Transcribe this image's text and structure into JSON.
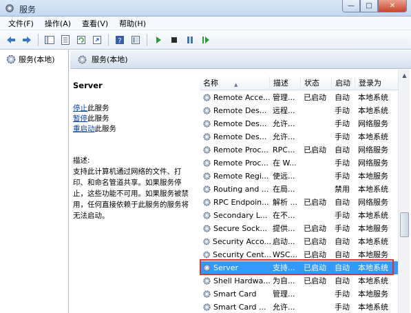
{
  "window": {
    "title": "服务",
    "minimize": "—",
    "maximize": "□",
    "close": "✕"
  },
  "menu": [
    "文件(F)",
    "操作(A)",
    "查看(V)",
    "帮助(H)"
  ],
  "tree": {
    "root_label": "服务(本地)"
  },
  "pane": {
    "header_label": "服务(本地)"
  },
  "details": {
    "service_name": "Server",
    "stop_link": "停止",
    "stop_rest": "此服务",
    "pause_link": "暂停",
    "pause_rest": "此服务",
    "restart_link": "重启动",
    "restart_rest": "此服务",
    "desc_label": "描述:",
    "desc_text": "支持此计算机通过网络的文件、打印、和命名管道共享。如果服务停止，这些功能不可用。如果服务被禁用，任何直接依赖于此服务的服务将无法启动。"
  },
  "columns": {
    "name": "名称",
    "description": "描述",
    "status": "状态",
    "startup": "启动",
    "logon": "登录为"
  },
  "services": [
    {
      "name": "Remote Acce...",
      "description": "管理...",
      "status": "已启动",
      "startup": "自动",
      "logon": "本地系统"
    },
    {
      "name": "Remote Des...",
      "description": "远程...",
      "status": "",
      "startup": "手动",
      "logon": "本地系统"
    },
    {
      "name": "Remote Des...",
      "description": "允许...",
      "status": "",
      "startup": "手动",
      "logon": "网络服务"
    },
    {
      "name": "Remote Des...",
      "description": "允许...",
      "status": "",
      "startup": "手动",
      "logon": "本地系统"
    },
    {
      "name": "Remote Proc...",
      "description": "RPC...",
      "status": "已启动",
      "startup": "自动",
      "logon": "网络服务"
    },
    {
      "name": "Remote Proc...",
      "description": "在 W...",
      "status": "",
      "startup": "手动",
      "logon": "网络服务"
    },
    {
      "name": "Remote Regi...",
      "description": "使远...",
      "status": "",
      "startup": "手动",
      "logon": "本地服务"
    },
    {
      "name": "Routing and ...",
      "description": "在局...",
      "status": "",
      "startup": "禁用",
      "logon": "本地系统"
    },
    {
      "name": "RPC Endpoin...",
      "description": "解析 ...",
      "status": "已启动",
      "startup": "自动",
      "logon": "网络服务"
    },
    {
      "name": "Secondary L...",
      "description": "在不...",
      "status": "",
      "startup": "手动",
      "logon": "本地系统"
    },
    {
      "name": "Secure Sock...",
      "description": "提供...",
      "status": "已启动",
      "startup": "手动",
      "logon": "本地服务"
    },
    {
      "name": "Security Acco...",
      "description": "启动...",
      "status": "已启动",
      "startup": "自动",
      "logon": "本地系统"
    },
    {
      "name": "Security Cent...",
      "description": "WSC...",
      "status": "已启动",
      "startup": "自动",
      "logon": "本地服务"
    },
    {
      "name": "Server",
      "description": "支持...",
      "status": "已启动",
      "startup": "自动",
      "logon": "本地系统",
      "selected": true
    },
    {
      "name": "Shell Hardwa...",
      "description": "为自...",
      "status": "已启动",
      "startup": "自动",
      "logon": "本地系统"
    },
    {
      "name": "Smart Card",
      "description": "管理...",
      "status": "",
      "startup": "手动",
      "logon": "本地服务"
    },
    {
      "name": "Smart Card ...",
      "description": "允许...",
      "status": "",
      "startup": "手动",
      "logon": "本地系统"
    }
  ],
  "icons": {
    "app": "gear-icon",
    "back": "back-arrow-icon",
    "forward": "forward-arrow-icon",
    "service": "service-gear-icon",
    "start": "play-icon",
    "stop": "stop-icon",
    "pause": "pause-icon",
    "restart": "restart-icon",
    "help": "help-icon"
  },
  "colors": {
    "selection": "#3399ff",
    "highlight_border": "#e0312a",
    "link": "#0645ad"
  }
}
